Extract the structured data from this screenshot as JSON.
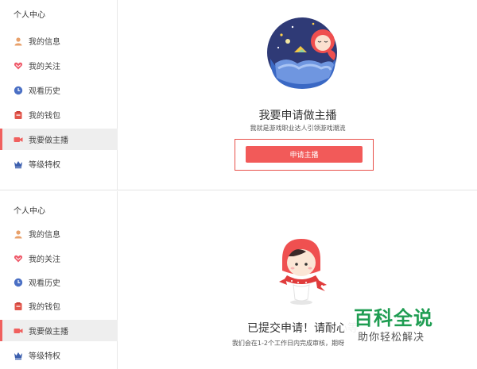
{
  "top_panel": {
    "sidebar": {
      "title": "个人中心",
      "items": [
        {
          "label": "我的信息",
          "icon": "user-icon",
          "active": false
        },
        {
          "label": "我的关注",
          "icon": "heart-icon",
          "active": false
        },
        {
          "label": "观看历史",
          "icon": "clock-icon",
          "active": false
        },
        {
          "label": "我的钱包",
          "icon": "wallet-icon",
          "active": false
        },
        {
          "label": "我要做主播",
          "icon": "camera-icon",
          "active": true
        },
        {
          "label": "等级特权",
          "icon": "crown-icon",
          "active": false
        }
      ]
    },
    "main": {
      "heading": "我要申请做主播",
      "subtitle": "我就是游戏职业达人引领游戏潮流",
      "button_label": "申请主播"
    }
  },
  "bottom_panel": {
    "sidebar": {
      "title": "个人中心",
      "items": [
        {
          "label": "我的信息",
          "icon": "user-icon",
          "active": false
        },
        {
          "label": "我的关注",
          "icon": "heart-icon",
          "active": false
        },
        {
          "label": "观看历史",
          "icon": "clock-icon",
          "active": false
        },
        {
          "label": "我的钱包",
          "icon": "wallet-icon",
          "active": false
        },
        {
          "label": "我要做主播",
          "icon": "camera-icon",
          "active": true
        },
        {
          "label": "等级特权",
          "icon": "crown-icon",
          "active": false
        }
      ]
    },
    "main": {
      "heading": "已提交申请！请耐心等",
      "subtitle": "我们会在1-2个工作日内完成审核，期呀"
    }
  },
  "watermark": {
    "title": "百科全说",
    "subtitle": "助你轻松解决"
  },
  "colors": {
    "accent": "#f25a59",
    "active_bg": "#eeeeee",
    "watermark_green": "#1f9d52"
  }
}
